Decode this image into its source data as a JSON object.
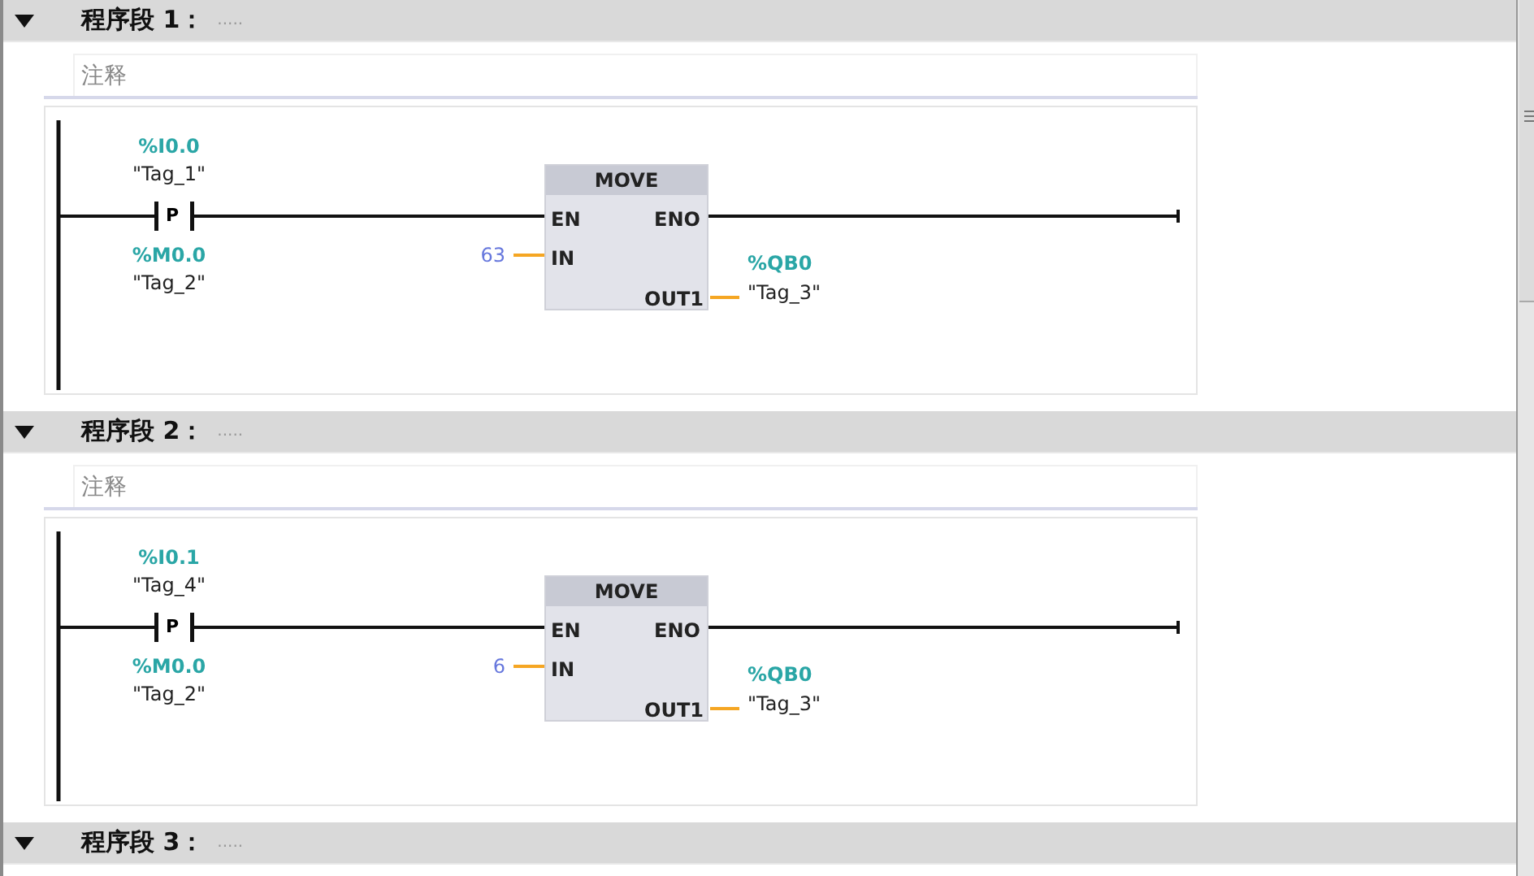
{
  "networks": [
    {
      "title": "程序段 1：",
      "expanded": true,
      "title_comment": ".....",
      "comment_placeholder": "注释",
      "rung": {
        "contact": {
          "label": "P",
          "operand": "%I0.0",
          "tag": "\"Tag_1\"",
          "edge_operand": "%M0.0",
          "edge_tag": "\"Tag_2\""
        },
        "box": {
          "name": "MOVE",
          "en": "EN",
          "eno": "ENO",
          "in": "IN",
          "out": "OUT1",
          "in_value": "63",
          "out_operand": "%QB0",
          "out_tag": "\"Tag_3\""
        }
      }
    },
    {
      "title": "程序段 2：",
      "expanded": true,
      "title_comment": ".....",
      "comment_placeholder": "注释",
      "rung": {
        "contact": {
          "label": "P",
          "operand": "%I0.1",
          "tag": "\"Tag_4\"",
          "edge_operand": "%M0.0",
          "edge_tag": "\"Tag_2\""
        },
        "box": {
          "name": "MOVE",
          "en": "EN",
          "eno": "ENO",
          "in": "IN",
          "out": "OUT1",
          "in_value": "6",
          "out_operand": "%QB0",
          "out_tag": "\"Tag_3\""
        }
      }
    },
    {
      "title": "程序段 3：",
      "expanded": true,
      "title_comment": "....."
    }
  ]
}
